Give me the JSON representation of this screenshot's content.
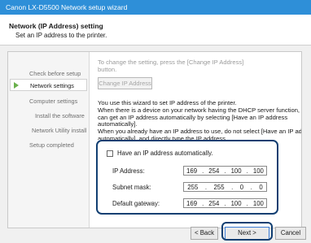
{
  "window": {
    "title": "Canon LX-D5500 Network setup wizard"
  },
  "header": {
    "title": "Network (IP Address) setting",
    "subtitle": "Set an IP address to the printer."
  },
  "sidebar": {
    "items": [
      {
        "label": "Check before setup"
      },
      {
        "label": "Network settings"
      },
      {
        "label": "Computer settings"
      },
      {
        "label": "Install the software"
      },
      {
        "label": "Network Utility install"
      },
      {
        "label": "Setup completed"
      }
    ]
  },
  "main": {
    "instruction_lines": [
      "To change the setting, press the [Change IP Address]",
      "button."
    ],
    "change_button": "Change IP Address",
    "description_lines": [
      "You use this wizard to set IP address of the printer.",
      "When there is a device on your network having the DHCP server function, you",
      "can get an IP address automatically by selecting [Have an IP address",
      "automatically].",
      "When you already have an IP address to use, do not select [Have an IP address",
      "automatically], and directly type the IP address."
    ],
    "checkbox_label": "Have an IP address automatically.",
    "checkbox_checked": false,
    "fields": [
      {
        "label": "IP Address:",
        "octets": [
          "169",
          "254",
          "100",
          "100"
        ]
      },
      {
        "label": "Subnet mask:",
        "octets": [
          "255",
          "255",
          "0",
          "0"
        ]
      },
      {
        "label": "Default gateway:",
        "octets": [
          "169",
          "254",
          "100",
          "100"
        ]
      }
    ]
  },
  "footer": {
    "back": "< Back",
    "next": "Next >",
    "cancel": "Cancel"
  }
}
